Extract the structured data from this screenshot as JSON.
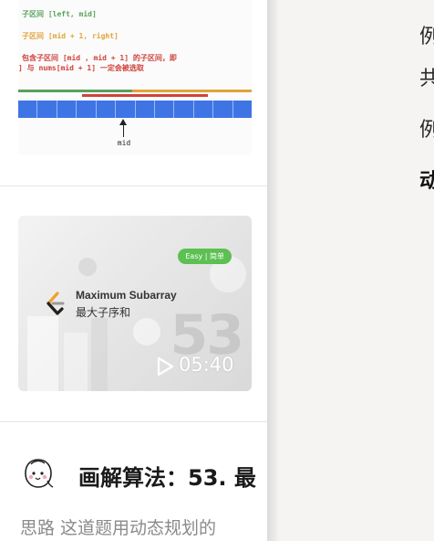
{
  "diagram": {
    "line1": "子区间 [left, mid]",
    "line2": "子区间 [mid + 1, right]",
    "line3": "包含子区间 [mid , mid + 1] 的子区间，即",
    "line4": "] 与 nums[mid + 1] 一定会被选取",
    "mid_label": "mid",
    "colors": {
      "green": "#58a15c",
      "orange": "#e0a43a",
      "red": "#d0423b",
      "cells": "#3f74e5"
    }
  },
  "video": {
    "badge": "Easy | 简单",
    "title_en": "Maximum Subarray",
    "title_zh": "最大子序和",
    "number": "53",
    "duration": "05:40",
    "icons": [
      "leetcode-logo-icon",
      "play-icon"
    ]
  },
  "article": {
    "title": "画解算法：53. 最",
    "snippet": "思路 这道题用动态规划的",
    "icons": [
      "avatar-face-icon"
    ]
  },
  "right_panel": {
    "line1": "例",
    "line2": "共",
    "line3": "例",
    "line4": "动"
  }
}
